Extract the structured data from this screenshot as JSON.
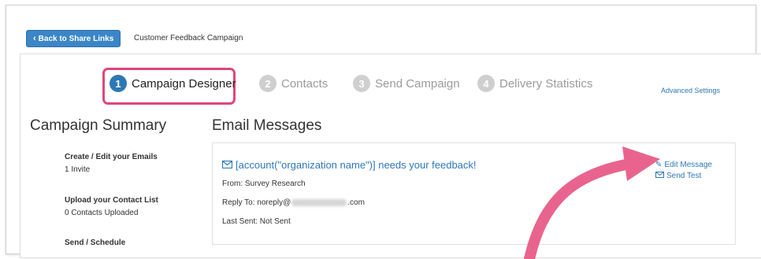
{
  "header": {
    "back_label": "Back to Share Links",
    "breadcrumb": "Customer Feedback Campaign"
  },
  "steps": [
    {
      "number": "1",
      "label": "Campaign Designer",
      "active": true
    },
    {
      "number": "2",
      "label": "Contacts",
      "active": false
    },
    {
      "number": "3",
      "label": "Send Campaign",
      "active": false
    },
    {
      "number": "4",
      "label": "Delivery Statistics",
      "active": false
    }
  ],
  "advanced_settings": "Advanced Settings",
  "summary": {
    "title": "Campaign Summary",
    "items": [
      {
        "heading": "Create / Edit your Emails",
        "sub": "1 Invite"
      },
      {
        "heading": "Upload your Contact List",
        "sub": "0 Contacts Uploaded"
      },
      {
        "heading": "Send / Schedule",
        "sub": ""
      }
    ]
  },
  "email": {
    "title": "Email Messages",
    "subject": "[account(\"organization name\")] needs your feedback!",
    "from": "From: Survey Research",
    "reply_to_prefix": "Reply To: noreply@",
    "reply_to_suffix": ".com",
    "last_sent": "Last Sent: Not Sent",
    "edit_label": "Edit Message",
    "send_test_label": "Send Test"
  },
  "colors": {
    "accent": "#2e77b5",
    "highlight": "#e0457b",
    "arrow": "#e8648e"
  },
  "icons": [
    "chevron-left-icon",
    "envelope-icon",
    "pencil-icon",
    "envelope-icon"
  ]
}
